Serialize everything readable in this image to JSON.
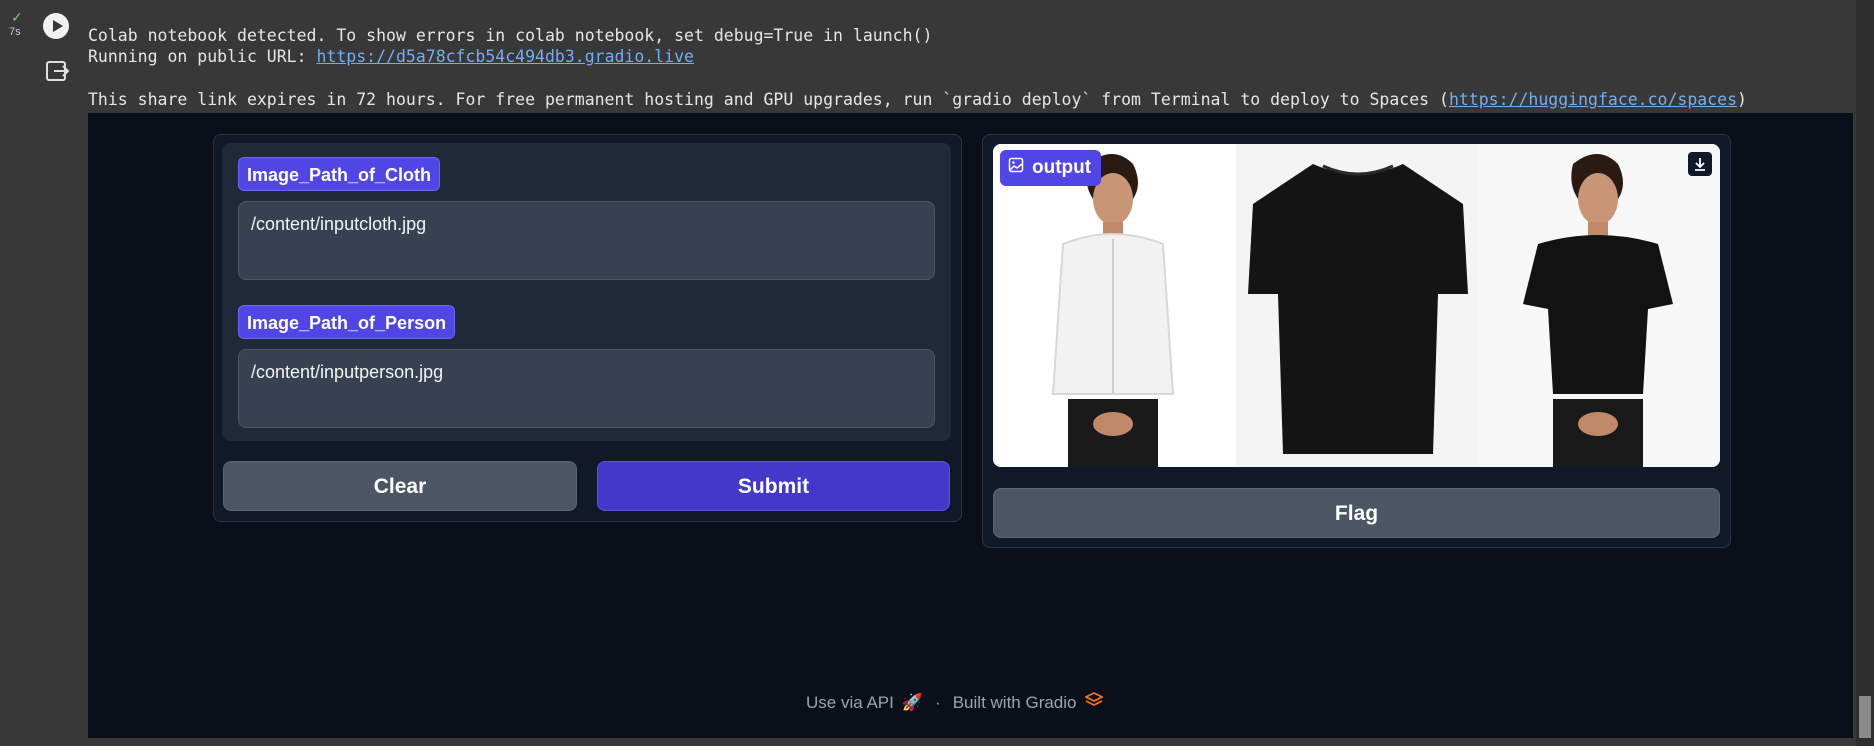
{
  "cell": {
    "exec_time": "7s",
    "status": "success"
  },
  "log": {
    "line1": "Colab notebook detected. To show errors in colab notebook, set debug=True in launch()",
    "line2_prefix": "Running on public URL: ",
    "line2_url": "https://d5a78cfcb54c494db3.gradio.live",
    "line3_prefix": "This share link expires in 72 hours. For free permanent hosting and GPU upgrades, run `gradio deploy` from Terminal to deploy to Spaces (",
    "line3_url": "https://huggingface.co/spaces",
    "line3_suffix": ")"
  },
  "inputs": {
    "cloth": {
      "label": "Image_Path_of_Cloth",
      "value": "/content/inputcloth.jpg"
    },
    "person": {
      "label": "Image_Path_of_Person",
      "value": "/content/inputperson.jpg"
    }
  },
  "buttons": {
    "clear": "Clear",
    "submit": "Submit",
    "flag": "Flag"
  },
  "output": {
    "label": "output"
  },
  "footer": {
    "api": "Use via API",
    "sep": "·",
    "built": "Built with Gradio"
  },
  "colors": {
    "accent": "#4f46e5",
    "submit": "#4338ca",
    "background": "#0b0f19"
  }
}
